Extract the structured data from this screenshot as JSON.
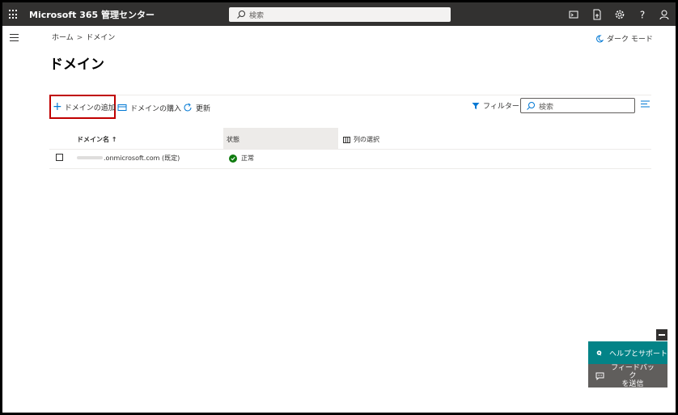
{
  "topbar": {
    "app_title": "Microsoft 365 管理センター",
    "search_placeholder": "検索"
  },
  "breadcrumb": {
    "home": "ホーム",
    "separator": ">",
    "current": "ドメイン"
  },
  "dark_mode_label": "ダーク モード",
  "page_title": "ドメイン",
  "toolbar": {
    "add_domain": "ドメインの追加",
    "buy_domain": "ドメインの購入",
    "refresh": "更新",
    "filter": "フィルター",
    "search_placeholder": "検索"
  },
  "table": {
    "headers": {
      "name": "ドメイン名 ↑",
      "status": "状態",
      "choose_columns": "列の選択"
    },
    "rows": [
      {
        "domain": ".onmicrosoft.com (既定)",
        "status": "正常"
      }
    ]
  },
  "help_panel": {
    "help": "ヘルプとサポート",
    "feedback": "フィードバック\nを送信"
  },
  "colors": {
    "topbar": "#323130",
    "accent": "#0078d4",
    "highlight_border": "#c00000",
    "help_teal": "#038387",
    "status_ok": "#107c10"
  }
}
